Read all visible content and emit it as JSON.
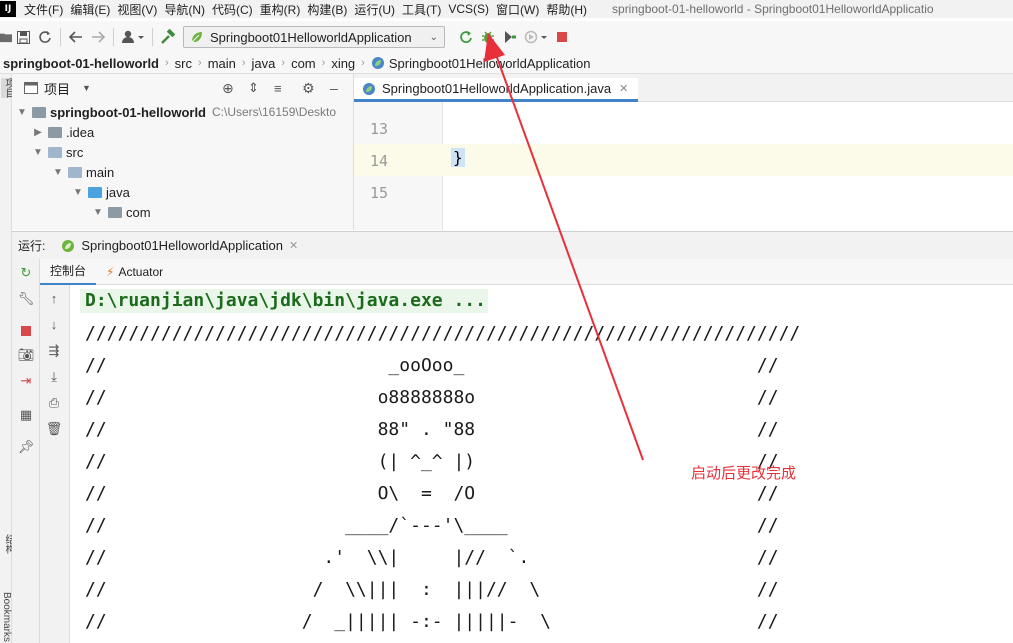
{
  "menubar": {
    "logo": "IJ",
    "items": [
      "文件(F)",
      "编辑(E)",
      "视图(V)",
      "导航(N)",
      "代码(C)",
      "重构(R)",
      "构建(B)",
      "运行(U)",
      "工具(T)",
      "VCS(S)",
      "窗口(W)",
      "帮助(H)"
    ],
    "window_title": "springboot-01-helloworld - Springboot01HelloworldApplicatio"
  },
  "toolbar": {
    "run_config": "Springboot01HelloworldApplication"
  },
  "breadcrumb": [
    "springboot-01-helloworld",
    "src",
    "main",
    "java",
    "com",
    "xing",
    "Springboot01HelloworldApplication"
  ],
  "left_strip": {
    "top_label": "项目",
    "mid_label": "结构",
    "bottom_label": "Bookmarks"
  },
  "project": {
    "title": "项目",
    "tree": [
      {
        "label": "springboot-01-helloworld",
        "hint": "C:\\Users\\16159\\Deskto",
        "depth": 0,
        "arrow": "▼",
        "bold": true
      },
      {
        "label": ".idea",
        "depth": 1,
        "arrow": "▶"
      },
      {
        "label": "src",
        "depth": 1,
        "arrow": "▼"
      },
      {
        "label": "main",
        "depth": 2,
        "arrow": "▼"
      },
      {
        "label": "java",
        "depth": 3,
        "arrow": "▼"
      },
      {
        "label": "com",
        "depth": 4,
        "arrow": "▼"
      }
    ]
  },
  "editor": {
    "tab": "Springboot01HelloworldApplication.java",
    "line_numbers": [
      "13",
      "14",
      "15"
    ],
    "current_line_text": "}"
  },
  "run": {
    "label": "运行:",
    "tab": "Springboot01HelloworldApplication",
    "subtabs": [
      "控制台",
      "Actuator"
    ],
    "command": "D:\\ruanjian\\java\\jdk\\bin\\java.exe ...",
    "lines": [
      "//////////////////////////////////////////////////////////////////",
      "//                          _ooOoo_                           //",
      "//                         o8888888o                          //",
      "//                         88\" . \"88                          //",
      "//                         (| ^_^ |)                          //",
      "//                         O\\  =  /O                          //",
      "//                      ____/`---'\\____                       //",
      "//                    .'  \\\\|     |//  `.                     //",
      "//                   /  \\\\|||  :  |||//  \\                    //",
      "//                  /  _||||| -:- |||||-  \\                   //"
    ]
  },
  "annotation": {
    "text": "启动后更改完成",
    "color": "#e8303a"
  }
}
